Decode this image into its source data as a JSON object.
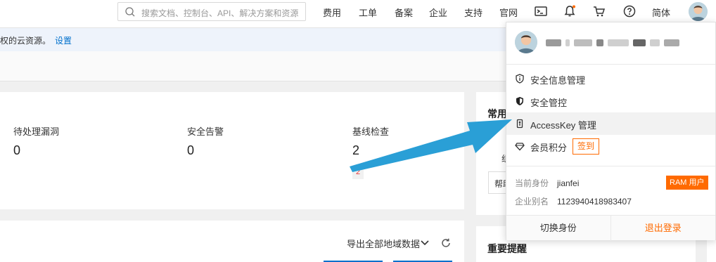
{
  "search": {
    "placeholder": "搜索文档、控制台、API、解决方案和资源"
  },
  "nav": {
    "items": [
      "费用",
      "工单",
      "备案",
      "企业",
      "支持",
      "官网"
    ],
    "lang": "简体"
  },
  "notice": {
    "text": "权的云资源。",
    "link": "设置"
  },
  "stats": [
    {
      "label": "待处理漏洞",
      "value": "0"
    },
    {
      "label": "安全告警",
      "value": "0"
    },
    {
      "label": "基线检查",
      "value": "2",
      "badge": "2"
    }
  ],
  "side_card": {
    "title": "常用",
    "tab_fragment": "组",
    "button_fragment": "帮助"
  },
  "bottom_card": {
    "export_label": "导出全部地域数据"
  },
  "reminder_card": {
    "title": "重要提醒"
  },
  "dropdown": {
    "menu": [
      {
        "label": "安全信息管理",
        "icon": "shield-info-icon"
      },
      {
        "label": "安全管控",
        "icon": "shield-filled-icon"
      },
      {
        "label": "AccessKey 管理",
        "icon": "key-icon",
        "active": true
      },
      {
        "label": "会员积分",
        "icon": "diamond-icon",
        "action": "签到"
      }
    ],
    "identity_label": "当前身份",
    "identity_value": "jianfei",
    "identity_badge": "RAM 用户",
    "alias_label": "企业别名",
    "alias_value": "1123940418983407",
    "switch_label": "切换身份",
    "logout_label": "退出登录"
  },
  "colors": {
    "accent": "#ff6a00",
    "link": "#0070cc",
    "arrow": "#2a9fd6"
  }
}
